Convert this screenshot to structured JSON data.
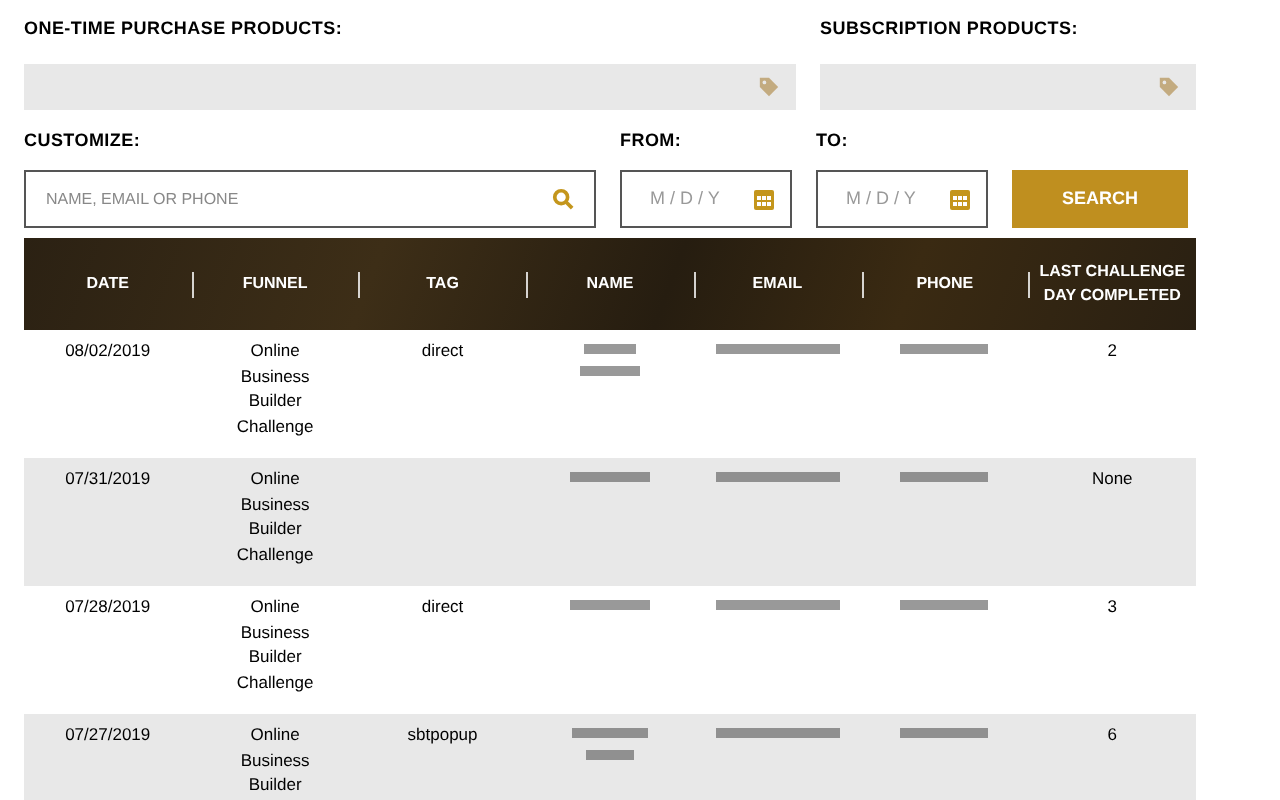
{
  "filters": {
    "one_time_label": "ONE-TIME PURCHASE PRODUCTS:",
    "subscription_label": "SUBSCRIPTION PRODUCTS:",
    "customize_label": "CUSTOMIZE:",
    "customize_placeholder": "NAME, EMAIL OR PHONE",
    "from_label": "FROM:",
    "from_placeholder": "M / D / Y",
    "to_label": "TO:",
    "to_placeholder": "M / D / Y",
    "search_button": "SEARCH"
  },
  "table": {
    "columns": [
      "DATE",
      "FUNNEL",
      "TAG",
      "NAME",
      "EMAIL",
      "PHONE",
      "LAST CHALLENGE DAY COMPLETED"
    ],
    "rows": [
      {
        "date": "08/02/2019",
        "funnel": "Online Business Builder Challenge",
        "tag": "direct",
        "last_day": "2"
      },
      {
        "date": "07/31/2019",
        "funnel": "Online Business Builder Challenge",
        "last_day": "None"
      },
      {
        "date": "07/28/2019",
        "funnel": "Online Business Builder Challenge",
        "tag": "direct",
        "last_day": "3"
      },
      {
        "date": "07/27/2019",
        "funnel": "Online Business Builder",
        "tag": "sbtpopup",
        "last_day": "6"
      }
    ]
  }
}
